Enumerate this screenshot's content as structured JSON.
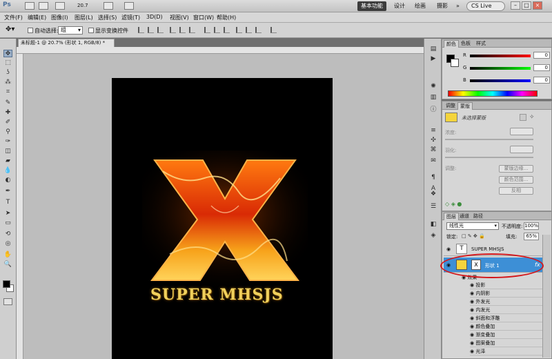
{
  "appbar": {
    "logo": "Ps",
    "zoom_value": "20.7",
    "workspaces": [
      "基本功能",
      "设计",
      "绘画",
      "摄影"
    ],
    "more": "»",
    "cs_live": "CS Live",
    "window_buttons": [
      "–",
      "□",
      "×"
    ]
  },
  "menubar": {
    "items": [
      "文件(F)",
      "编辑(E)",
      "图像(I)",
      "图层(L)",
      "选择(S)",
      "滤镜(T)",
      "3D(D)",
      "视图(V)",
      "窗口(W)",
      "帮助(H)"
    ]
  },
  "options": {
    "auto_select_label": "自动选择:",
    "auto_select_value": "组",
    "show_transform_label": "显示变换控件"
  },
  "document": {
    "tab_title": "未标题-1 @ 20.7% (形状 1, RGB/8) *",
    "artwork_letter": "X",
    "artwork_text": "SUPER MHSJS"
  },
  "toolbox": {
    "icons": [
      "move-icon",
      "marquee-icon",
      "lasso-icon",
      "quick-select-icon",
      "crop-icon",
      "eyedropper-icon",
      "healing-icon",
      "brush-icon",
      "clone-stamp-icon",
      "history-brush-icon",
      "eraser-icon",
      "gradient-icon",
      "blur-icon",
      "dodge-icon",
      "pen-icon",
      "type-icon",
      "path-select-icon",
      "shape-icon",
      "3d-rotate-icon",
      "3d-orbit-icon",
      "hand-icon",
      "zoom-icon"
    ],
    "glyphs": [
      "✥",
      "⬚",
      "ʖ",
      "⁂",
      "⌗",
      "✎",
      "✚",
      "✐",
      "⚲",
      "✑",
      "◫",
      "▰",
      "💧",
      "◐",
      "✒",
      "T",
      "➤",
      "▭",
      "⟲",
      "◎",
      "✋",
      "🔍"
    ]
  },
  "color_panel": {
    "tabs": [
      "颜色",
      "色板",
      "样式"
    ],
    "r_label": "R",
    "g_label": "G",
    "b_label": "B",
    "r_value": "0",
    "g_value": "0",
    "b_value": "0"
  },
  "adjust_panel": {
    "tabs": [
      "调整",
      "蒙版"
    ],
    "title": "未选择蒙版",
    "density_label": "浓度:",
    "feather_label": "羽化:",
    "refine_label": "调整:",
    "btn_mask_edge": "蒙版边缘...",
    "btn_color_range": "颜色范围...",
    "btn_invert": "反相"
  },
  "layers_panel": {
    "tabs": [
      "图层",
      "通道",
      "路径"
    ],
    "blend_mode": "线性光",
    "opacity_label": "不透明度:",
    "opacity_value": "100%",
    "lock_label": "锁定:",
    "fill_label": "填充:",
    "fill_value": "65%",
    "text_layer": "SUPER MHSJS",
    "shape_layer": "形状 1",
    "fx_group": "效果",
    "effects": [
      "投影",
      "内阴影",
      "外发光",
      "内发光",
      "斜面和浮雕",
      "颜色叠加",
      "渐变叠加",
      "图案叠加",
      "光泽"
    ]
  },
  "colors": {
    "selected_layer": "#3d8fd6",
    "highlight_ellipse": "#d4161a",
    "swatch_yellow": "#f4d43c"
  }
}
